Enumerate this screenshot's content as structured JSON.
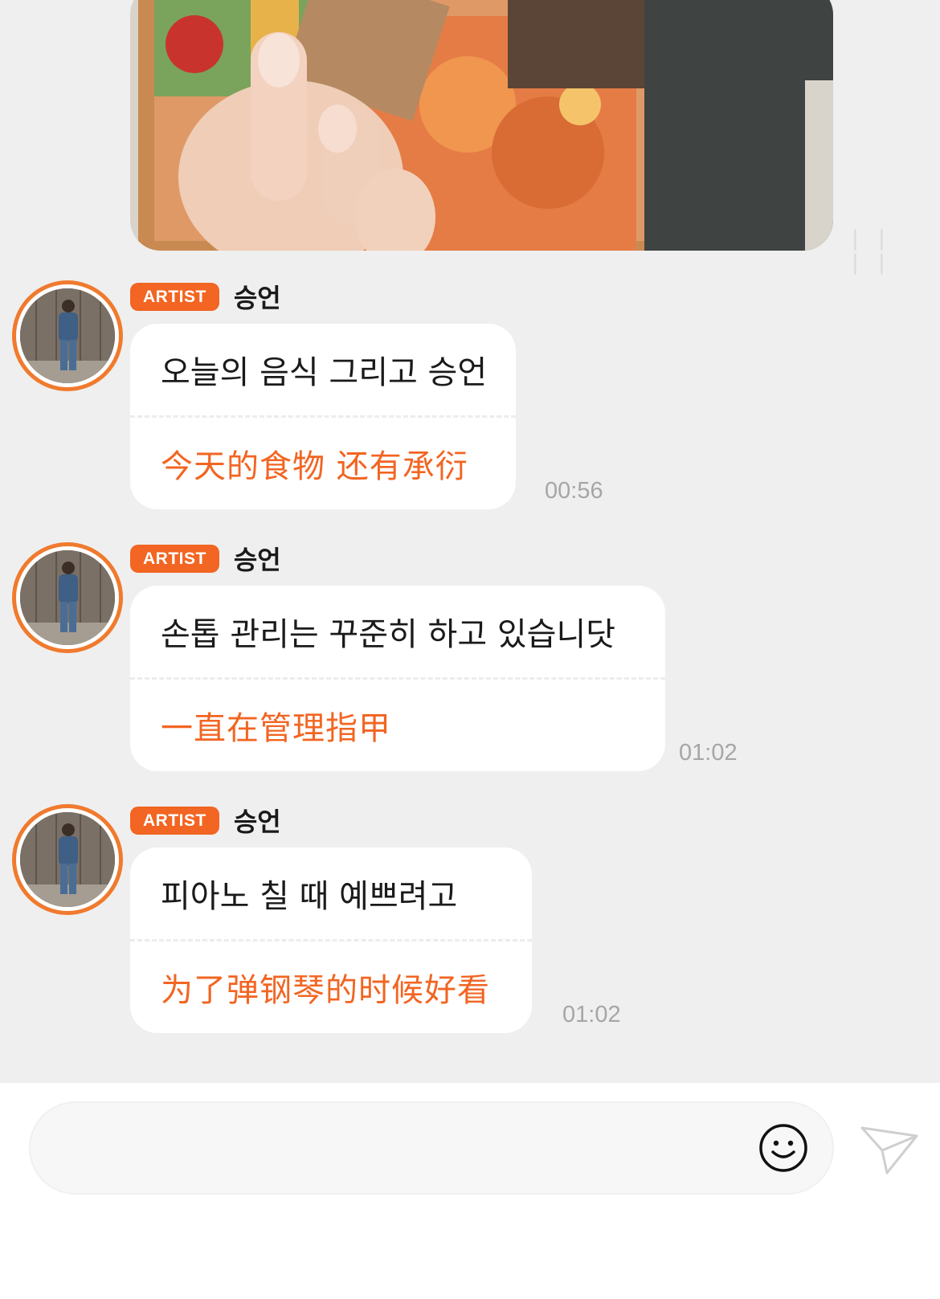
{
  "photo": {
    "alt": "",
    "time_stub": "| | | |"
  },
  "messages": [
    {
      "badge": "ARTIST",
      "sender": "승언",
      "text_ko": "오늘의 음식 그리고 승언",
      "text_zh": "今天的食物 还有承衍",
      "time": "00:56"
    },
    {
      "badge": "ARTIST",
      "sender": "승언",
      "text_ko": "손톱 관리는 꾸준히 하고 있습니닷",
      "text_zh": "一直在管理指甲",
      "time": "01:02"
    },
    {
      "badge": "ARTIST",
      "sender": "승언",
      "text_ko": "피아노 칠 때 예쁘려고",
      "text_zh": "为了弹钢琴的时候好看",
      "time": "01:02"
    }
  ],
  "input": {
    "value": "",
    "placeholder": ""
  },
  "icons": {
    "emoji": "smiley-face-icon",
    "send": "paper-plane-icon"
  },
  "colors": {
    "accent": "#f26522",
    "chat_background": "#efefef",
    "bubble": "#ffffff",
    "timestamp": "#a6a6a6"
  }
}
